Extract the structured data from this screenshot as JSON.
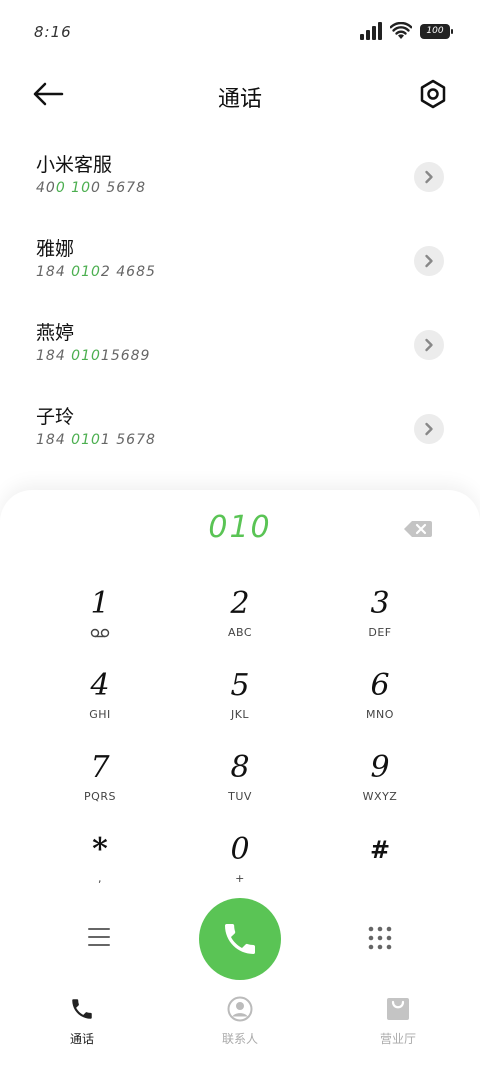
{
  "status_bar": {
    "time": "8:16",
    "battery": "100"
  },
  "header": {
    "title": "通话"
  },
  "contacts": [
    {
      "name": "小米客服",
      "number_pre": "40",
      "number_hl": "0 10",
      "number_post": "0 5678"
    },
    {
      "name": "雅娜",
      "number_pre": "184 ",
      "number_hl": "010",
      "number_post": "2 4685"
    },
    {
      "name": "燕婷",
      "number_pre": "184 ",
      "number_hl": "010",
      "number_post": "15689"
    },
    {
      "name": "子玲",
      "number_pre": "184 ",
      "number_hl": "010",
      "number_post": "1 5678"
    }
  ],
  "dialpad": {
    "input": "010",
    "keys": [
      {
        "digit": "1",
        "letters": ""
      },
      {
        "digit": "2",
        "letters": "ABC"
      },
      {
        "digit": "3",
        "letters": "DEF"
      },
      {
        "digit": "4",
        "letters": "GHI"
      },
      {
        "digit": "5",
        "letters": "JKL"
      },
      {
        "digit": "6",
        "letters": "MNO"
      },
      {
        "digit": "7",
        "letters": "PQRS"
      },
      {
        "digit": "8",
        "letters": "TUV"
      },
      {
        "digit": "9",
        "letters": "WXYZ"
      },
      {
        "digit": "*",
        "letters": ","
      },
      {
        "digit": "0",
        "letters": "+"
      },
      {
        "digit": "#",
        "letters": ""
      }
    ]
  },
  "tabs": [
    {
      "label": "通话",
      "icon": "phone-icon",
      "active": true
    },
    {
      "label": "联系人",
      "icon": "contacts-icon",
      "active": false
    },
    {
      "label": "营业厅",
      "icon": "store-icon",
      "active": false
    }
  ],
  "colors": {
    "accent": "#5ac455",
    "highlight": "#4caf50"
  }
}
